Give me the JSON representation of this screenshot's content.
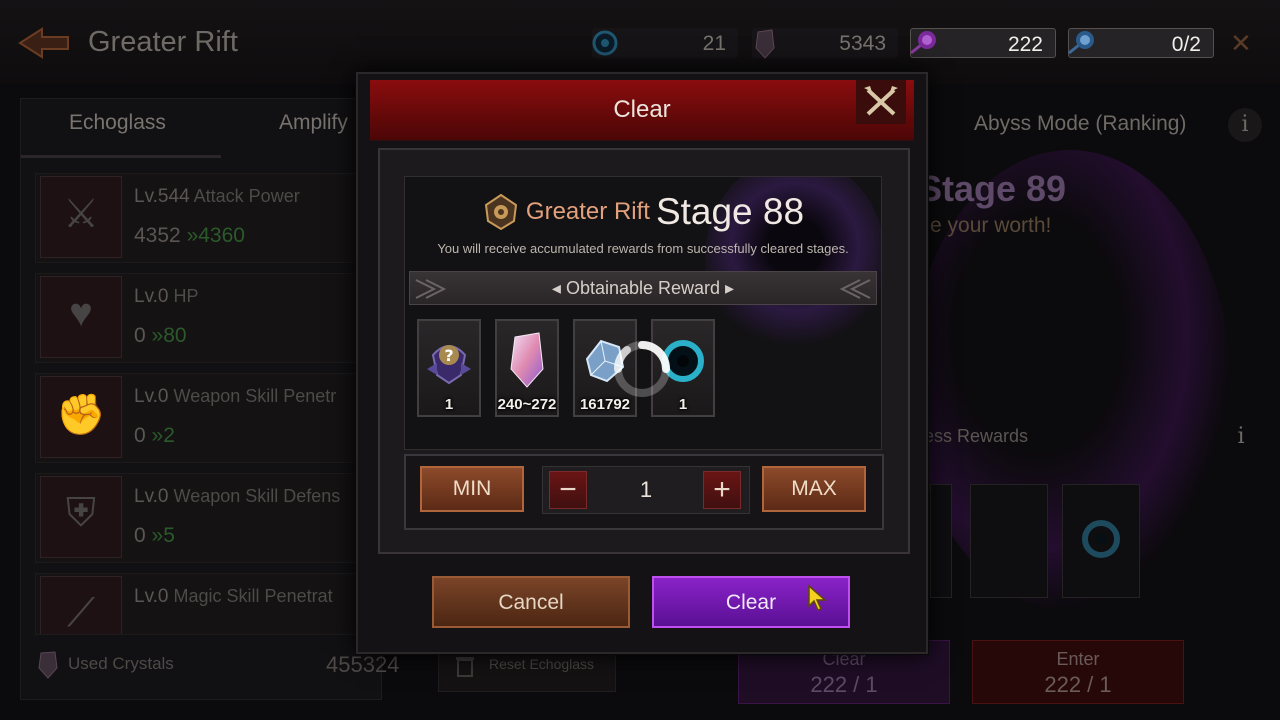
{
  "header": {
    "title": "Greater Rift",
    "currencies": [
      {
        "icon": "blue-orb-icon",
        "value": "21"
      },
      {
        "icon": "crystal-shard-icon",
        "value": "5343"
      },
      {
        "icon": "purple-rose-icon",
        "value": "222"
      },
      {
        "icon": "blue-rose-icon",
        "value": "0/2"
      }
    ]
  },
  "left_panel": {
    "tabs": [
      "Echoglass",
      "Amplify"
    ],
    "stats": [
      {
        "level": "Lv.544",
        "name": "Attack Power",
        "current": "4352",
        "next": "4360",
        "icon": "swords-icon"
      },
      {
        "level": "Lv.0",
        "name": "HP",
        "current": "0",
        "next": "80",
        "icon": "heart-icon"
      },
      {
        "level": "Lv.0",
        "name": "Weapon Skill Penetr",
        "current": "0",
        "next": "2",
        "icon": "fist-icon"
      },
      {
        "level": "Lv.0",
        "name": "Weapon Skill Defens",
        "current": "0",
        "next": "5",
        "icon": "shield-icon"
      },
      {
        "level": "Lv.0",
        "name": "Magic Skill Penetrat",
        "current": "",
        "next": "",
        "icon": "magic-blade-icon"
      }
    ],
    "used_crystals_label": "Used Crystals",
    "used_crystals_value": "455324",
    "reset_label": "Reset Echoglass"
  },
  "right_panel": {
    "tab": "Abyss Mode (Ranking)",
    "stage": "Stage 89",
    "tagline": "e your worth!",
    "progress_label": "ress Rewards",
    "clear_button": {
      "label": "Clear",
      "count": "222 / 1"
    },
    "enter_button": {
      "label": "Enter",
      "count": "222 / 1"
    }
  },
  "modal": {
    "title": "Clear",
    "rift_name": "Greater Rift",
    "stage": "Stage 88",
    "description": "You will receive accumulated rewards from successfully cleared stages.",
    "reward_header": "Obtainable Reward",
    "rewards": [
      {
        "icon": "mystery-gem-icon",
        "quantity": "1"
      },
      {
        "icon": "rainbow-crystal-icon",
        "quantity": "240~272"
      },
      {
        "icon": "blue-crystal-icon",
        "quantity": "161792"
      },
      {
        "icon": "blue-orb-icon",
        "quantity": "1"
      }
    ],
    "min_label": "MIN",
    "max_label": "MAX",
    "minus_label": "−",
    "plus_label": "+",
    "quantity": "1",
    "cancel_label": "Cancel",
    "confirm_label": "Clear"
  },
  "colors": {
    "modal_header": "#8a0d0e",
    "confirm_button": "#8a22c8",
    "min_max_button": "#8c4a2a",
    "rift_name": "#e3a07c"
  }
}
